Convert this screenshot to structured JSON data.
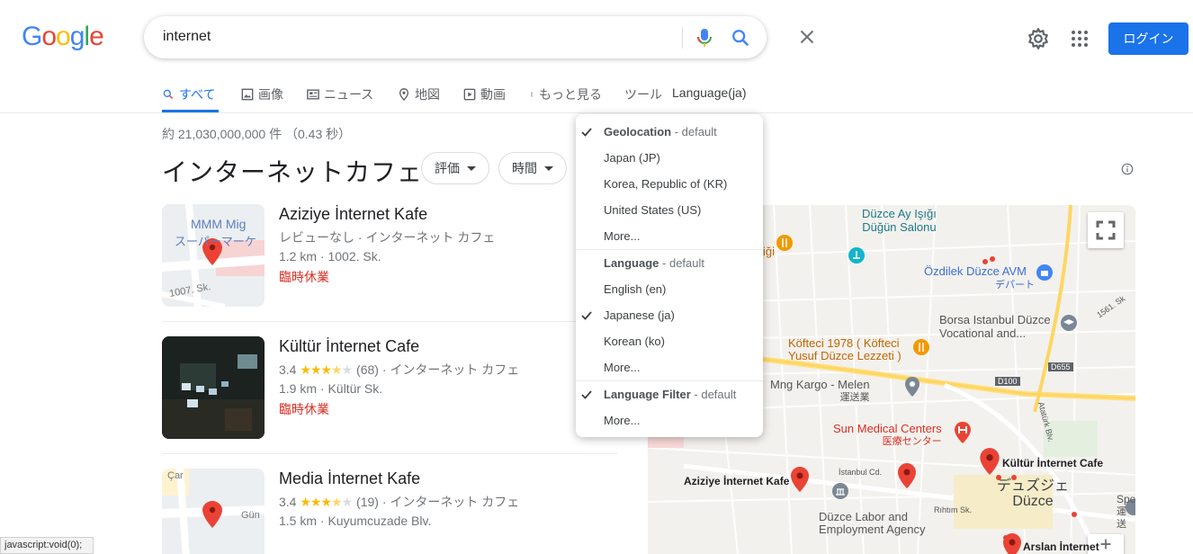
{
  "header": {
    "search_query": "internet",
    "login_label": "ログイン"
  },
  "tabs": [
    {
      "label": "すべて"
    },
    {
      "label": "画像"
    },
    {
      "label": "ニュース"
    },
    {
      "label": "地図"
    },
    {
      "label": "動画"
    },
    {
      "label": "もっと見る"
    },
    {
      "label": "ツール"
    },
    {
      "label": "Language(ja)"
    }
  ],
  "stats": "約 21,030,000,000 件 （0.43 秒）",
  "heading": "インターネットカフェ",
  "filters": [
    {
      "label": "評価"
    },
    {
      "label": "時間"
    }
  ],
  "results": [
    {
      "title": "Aziziye İnternet Kafe",
      "line1": "レビューなし · インターネット カフェ",
      "line2": "1.2 km · 1002. Sk.",
      "status": "臨時休業",
      "thumb_text_a": "MMM Mig",
      "thumb_text_b": "スーパーマーケ",
      "thumb_text_c": "1007. Sk."
    },
    {
      "title": "Kültür İnternet Cafe",
      "rating": "3.4",
      "stars": "★★★",
      "half": "★",
      "empty": "★",
      "reviews": "(68) · インターネット カフェ",
      "line2": "1.9 km · Kültür Sk.",
      "status": "臨時休業"
    },
    {
      "title": "Media İnternet Kafe",
      "rating": "3.4",
      "stars": "★★★",
      "half": "★",
      "empty": "★",
      "reviews": "(19) · インターネット カフェ",
      "line2": "1.5 km · Kuyumcuzade Blv.",
      "thumb_text_a": "Çar",
      "thumb_text_b": "Gün"
    }
  ],
  "dropdown": {
    "geo_header": "Geolocation",
    "geo_default": " - default",
    "geo_items": [
      "Japan (JP)",
      "Korea, Republic of (KR)",
      "United States (US)",
      "More..."
    ],
    "lang_header": "Language",
    "lang_default": " - default",
    "lang_items": [
      "English (en)",
      "Japanese (ja)",
      "Korean (ko)",
      "More..."
    ],
    "filter_header": "Language Filter",
    "filter_default": " - default",
    "filter_more": "More..."
  },
  "map": {
    "labels": {
      "duzce_ay": "Düzce Ay Işığı",
      "dugun": "Düğün Salonu",
      "igi": "iği",
      "ozdilek": "Özdilek Düzce AVM",
      "depato": "デパート",
      "street_1561": "1561. Sk",
      "borsa1": "Borsa Istanbul Düzce",
      "borsa2": "Vocational and...",
      "kofteci1": "Köfteci 1978 ( Köfteci",
      "kofteci2": "Yusuf Düzce Lezzeti )",
      "d655": "D655",
      "d100": "D100",
      "mng": "Mng Kargo - Melen",
      "unsogyo": "運送業",
      "sun1": "Sun Medical Centers",
      "sun2": "医療センター",
      "ataturk": "Atatürk Blv.",
      "kultur": "Kültür İnternet Cafe",
      "aziziye": "Aziziye İnternet Kafe",
      "istanbul_cd": "İstanbul Cd.",
      "duzuje": "デュズジェ",
      "duzce": "Düzce",
      "rihtim": "Rıhtım Sk.",
      "labor1": "Düzce Labor and",
      "labor2": "Employment Agency",
      "arslan": "Arslan İnternet",
      "spe1": "Spe",
      "spe2": "運送"
    }
  },
  "status_bar": "javascript:void(0);",
  "colors": {
    "accent": "#1a73e8",
    "red": "#d93025",
    "star": "#fbbc04",
    "orange": "#f29900",
    "teal": "#12b5cb",
    "map_bg": "#f5f3ef"
  }
}
